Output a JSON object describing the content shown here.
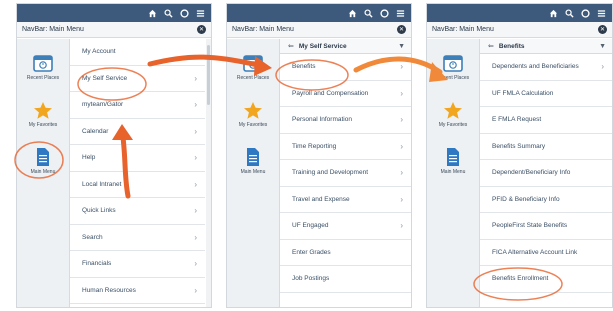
{
  "colors": {
    "topbar": "#3d5a7d",
    "annotation": "#e8622c"
  },
  "topbar_icons": [
    "home-icon",
    "search-icon",
    "notification-icon",
    "menu-icon"
  ],
  "panel1": {
    "navbar_title": "NavBar: Main Menu",
    "side": [
      {
        "label": "Recent Places",
        "icon": "calendar-icon"
      },
      {
        "label": "My Favorites",
        "icon": "star-icon"
      },
      {
        "label": "Main Menu",
        "icon": "document-icon"
      }
    ],
    "items": [
      "My Account",
      "My Self Service",
      "myteam/Gator",
      "Calendar",
      "Help",
      "Local Intranet",
      "Quick Links",
      "Search",
      "Financials",
      "Human Resources"
    ]
  },
  "panel2": {
    "navbar_title": "NavBar: Main Menu",
    "crumb": "My Self Service",
    "side": [
      {
        "label": "Recent Places",
        "icon": "calendar-icon"
      },
      {
        "label": "My Favorites",
        "icon": "star-icon"
      },
      {
        "label": "Main Menu",
        "icon": "document-icon"
      }
    ],
    "items": [
      "Benefits",
      "Payroll and Compensation",
      "Personal Information",
      "Time Reporting",
      "Training and Development",
      "Travel and Expense",
      "UF Engaged",
      "Enter Grades",
      "Job Postings"
    ]
  },
  "panel3": {
    "navbar_title": "NavBar: Main Menu",
    "crumb": "Benefits",
    "side": [
      {
        "label": "Recent Places",
        "icon": "calendar-icon"
      },
      {
        "label": "My Favorites",
        "icon": "star-icon"
      },
      {
        "label": "Main Menu",
        "icon": "document-icon"
      }
    ],
    "items": [
      "Dependents and Beneficiaries",
      "UF FMLA Calculation",
      "E FMLA Request",
      "Benefits Summary",
      "Dependent/Beneficiary Info",
      "PFID & Beneficiary Info",
      "PeopleFirst State Benefits",
      "FICA Alternative Account Link",
      "Benefits Enrollment"
    ]
  }
}
